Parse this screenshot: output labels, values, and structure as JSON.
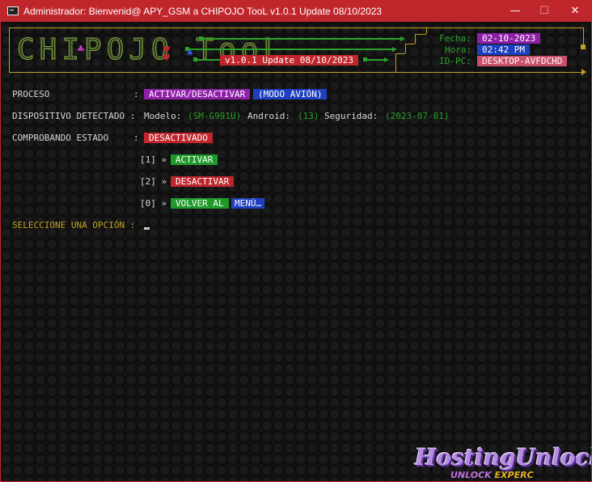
{
  "window": {
    "title": "Administrador:  Bienvenid@ APY_GSM a CHIPOJO TooL v1.0.1 Update 08/10/2023",
    "controls": {
      "minimize": "—",
      "maximize": "☐",
      "close": "✕"
    }
  },
  "banner": {
    "logo": "CHIPOJO TooL",
    "version_label": "v1.0.1 Update 08/10/2023",
    "fecha_label": "Fecha:",
    "fecha_value": "02-10-2023",
    "hora_label": "Hora:",
    "hora_value": "02:42 PM",
    "idpc_label": "ID-PC:",
    "idpc_value": "DESKTOP-AVFDCHD"
  },
  "console": {
    "proceso_label": "PROCESO",
    "colon": ":",
    "proceso_value": "ACTIVAR/DESACTIVAR",
    "proceso_mode": "(MODO AVIÓN)",
    "dispositivo_label": "DISPOSITIVO DETECTADO :",
    "modelo_label": "Modelo:",
    "modelo_value": "(SM-G991U)",
    "android_label": "Android:",
    "android_value": "(13)",
    "seguridad_label": "Seguridad:",
    "seguridad_value": "(2023-07-01)",
    "estado_label": "COMPROBANDO ESTADO",
    "estado_value": "DESACTIVADO",
    "options": [
      {
        "key": "[1] »",
        "label": "ACTIVAR"
      },
      {
        "key": "[2] »",
        "label": "DESACTIVAR"
      },
      {
        "key": "[0] »",
        "label": "VOLVER AL",
        "label2": "MENÚ…"
      }
    ],
    "prompt": "SELECCIONE UNA OPCIÓN :"
  },
  "watermark": {
    "line1": "HostingUnlock",
    "line2a": "UNLOCK ",
    "line2b": "EXPERC"
  },
  "colors": {
    "titlebar": "#c0272d",
    "green": "#2aa12a",
    "yellow": "#c0a020",
    "purple": "#8e1fa8",
    "blue": "#1e3fbf",
    "red": "#c0272d"
  }
}
